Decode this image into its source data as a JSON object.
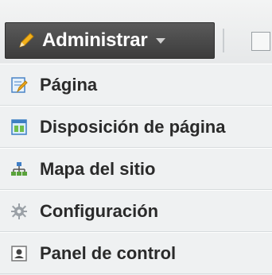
{
  "toolbar": {
    "admin_label": "Administrar",
    "icons": {
      "admin": "pencil-icon",
      "caret": "caret-down-icon",
      "box": "checkbox-square-icon"
    }
  },
  "menu": {
    "items": [
      {
        "label": "Página",
        "icon": "page-edit-icon"
      },
      {
        "label": "Disposición de página",
        "icon": "page-layout-icon"
      },
      {
        "label": "Mapa del sitio",
        "icon": "sitemap-icon"
      },
      {
        "label": "Configuración",
        "icon": "gear-icon"
      },
      {
        "label": "Panel de control",
        "icon": "user-panel-icon"
      }
    ]
  },
  "colors": {
    "button_bg": "#4a4a4a",
    "menu_bg": "#eff1f2",
    "text": "#2a2a2a"
  }
}
